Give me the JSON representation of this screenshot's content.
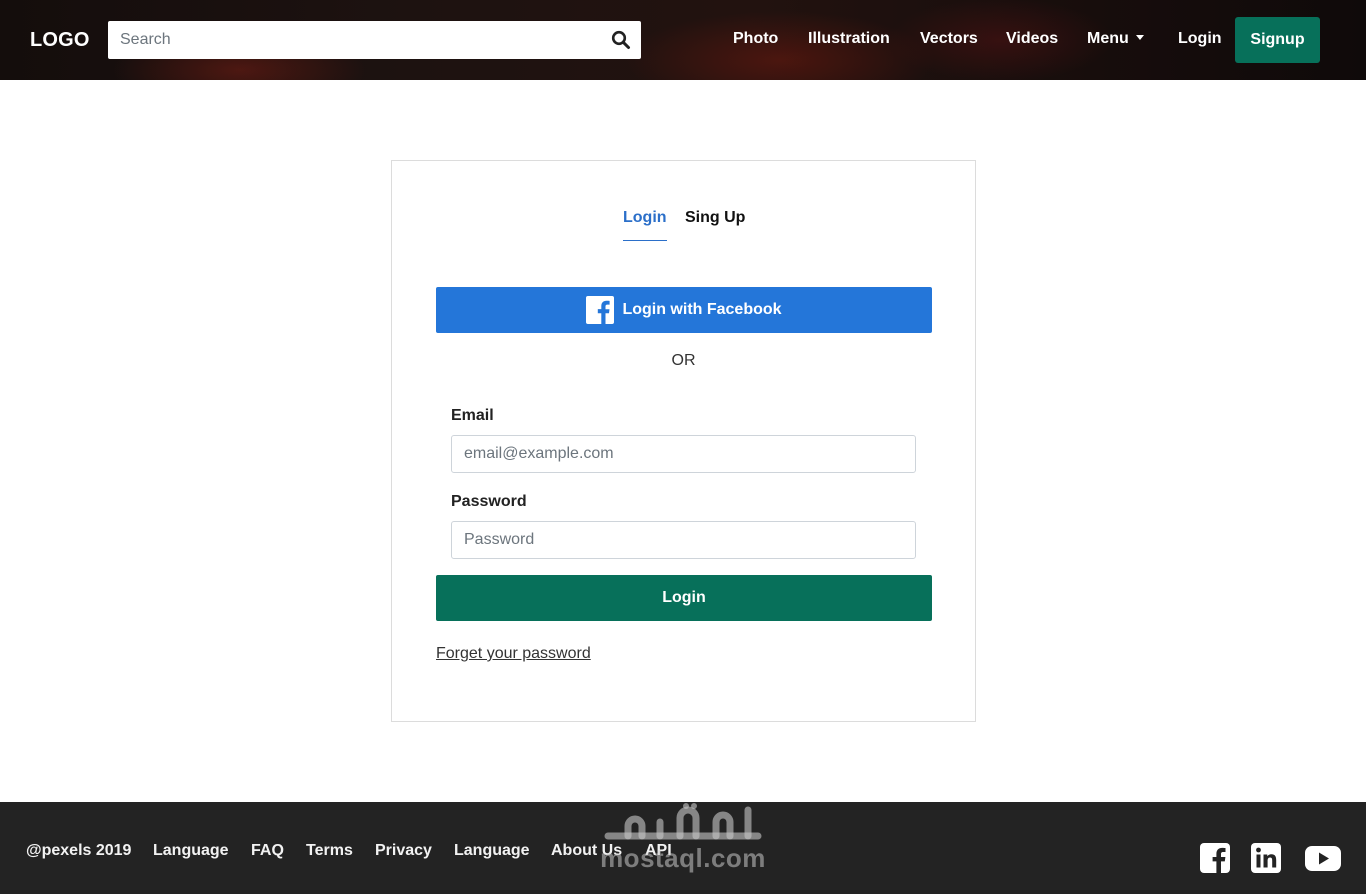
{
  "header": {
    "logo": "LOGO",
    "search": {
      "placeholder": "Search",
      "value": ""
    },
    "nav": [
      {
        "label": "Photo"
      },
      {
        "label": "Illustration"
      },
      {
        "label": "Vectors"
      },
      {
        "label": "Videos"
      },
      {
        "label": "Menu"
      },
      {
        "label": "Login"
      }
    ],
    "signup_label": "Signup"
  },
  "card": {
    "tabs": {
      "login": "Login",
      "signup": "Sing Up",
      "active": "Login"
    },
    "facebook_button": "Login with Facebook",
    "or_text": "OR",
    "email": {
      "label": "Email",
      "placeholder": "email@example.com",
      "value": ""
    },
    "password": {
      "label": "Password",
      "placeholder": "Password",
      "value": ""
    },
    "login_button": "Login",
    "forgot_link": "Forget your password"
  },
  "footer": {
    "copyright": "@pexels 2019",
    "links": [
      {
        "label": "Language"
      },
      {
        "label": "FAQ"
      },
      {
        "label": "Terms"
      },
      {
        "label": "Privacy"
      },
      {
        "label": "Language"
      },
      {
        "label": "About Us"
      },
      {
        "label": "API"
      }
    ],
    "social": [
      "facebook-icon",
      "linkedin-icon",
      "youtube-icon"
    ]
  },
  "watermark": {
    "text_latin": "mostaql.com",
    "text_arabic": "مستقل"
  },
  "colors": {
    "accent_green": "#07705a",
    "facebook_blue": "#2476d9",
    "tab_active_blue": "#2b6fc9",
    "footer_bg": "#232323"
  }
}
